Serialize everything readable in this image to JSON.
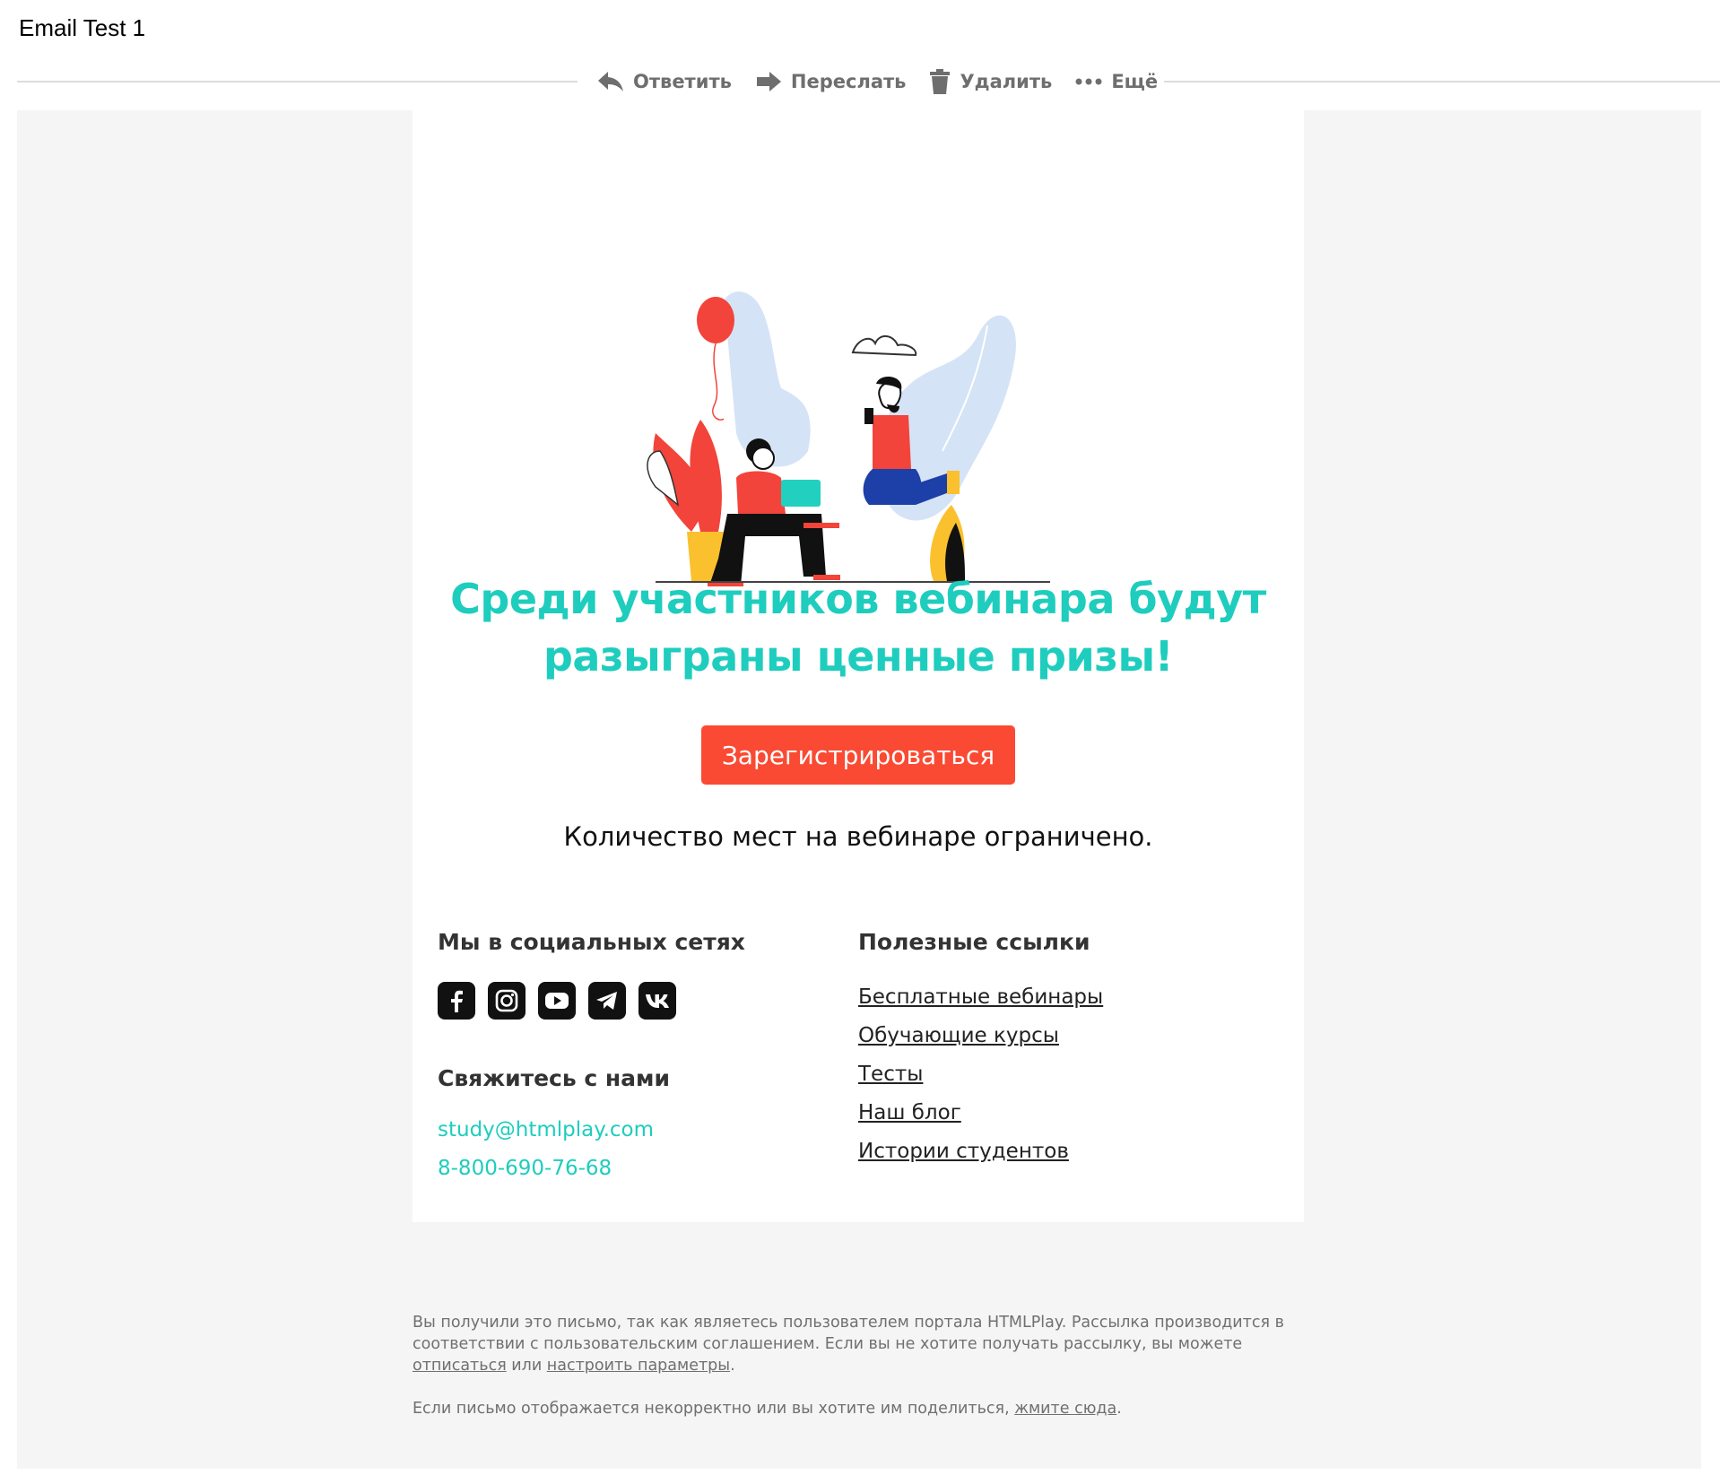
{
  "window": {
    "subject": "Email Test 1"
  },
  "toolbar": {
    "reply_label": "Ответить",
    "forward_label": "Переслать",
    "delete_label": "Удалить",
    "more_label": "Ещё"
  },
  "email": {
    "headline_line1": "Среди участников вебинара будут",
    "headline_line2": "разыграны ценные призы!",
    "cta_label": "Зарегистрироваться",
    "limit_note": "Количество мест на вебинаре ограничено.",
    "social": {
      "title": "Мы в социальных сетях",
      "icons": [
        "facebook-icon",
        "instagram-icon",
        "youtube-icon",
        "telegram-icon",
        "vk-icon"
      ]
    },
    "contact": {
      "title": "Свяжитесь с нами",
      "email": "study@htmlplay.com",
      "phone": "8-800-690-76-68"
    },
    "links": {
      "title": "Полезные ссылки",
      "items": [
        "Бесплатные вебинары",
        "Обучающие курсы",
        "Тесты",
        "Наш блог",
        "Истории студентов"
      ]
    },
    "footer": {
      "p1_text_a": "Вы получили это письмо, так как являетесь пользователем портала HTMLPlay. Рассылка производится в соответствии с пользовательским соглашением. Если вы не хотите получать рассылку, вы можете ",
      "unsubscribe": "отписаться",
      "p1_text_b": " или ",
      "settings": "настроить параметры",
      "p1_text_c": ".",
      "p2_text_a": "Если письмо отображается некорректно или вы хотите им поделиться, ",
      "click_here": "жмите сюда",
      "p2_text_b": "."
    }
  },
  "colors": {
    "accent": "#1ecdbd",
    "cta": "#fa4a33",
    "panel_bg": "#f5f5f5"
  }
}
